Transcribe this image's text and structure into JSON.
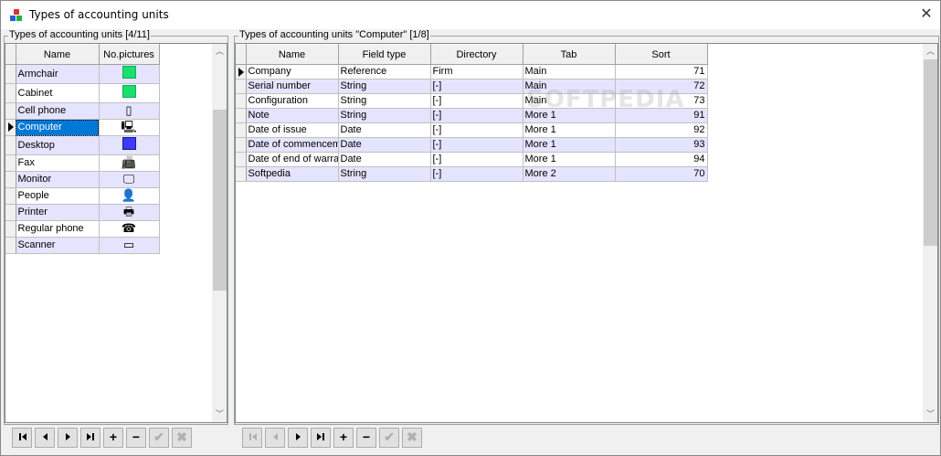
{
  "window": {
    "title": "Types of accounting units",
    "close_glyph": "✕",
    "app_icon": "cubes-icon"
  },
  "left": {
    "group_label": "Types of accounting units [4/11]",
    "columns": [
      "Name",
      "No.pictures"
    ],
    "rows": [
      {
        "name": "Armchair",
        "pic": "green-square"
      },
      {
        "name": "Cabinet",
        "pic": "green-square"
      },
      {
        "name": "Cell phone",
        "pic": "cell-phone-icon",
        "glyph": "▯"
      },
      {
        "name": "Computer",
        "pic": "computer-icon",
        "glyph": "🖳",
        "selected": true
      },
      {
        "name": "Desktop",
        "pic": "blue-square"
      },
      {
        "name": "Fax",
        "pic": "fax-icon",
        "glyph": "📠"
      },
      {
        "name": "Monitor",
        "pic": "monitor-icon",
        "glyph": "🖵"
      },
      {
        "name": "People",
        "pic": "person-icon",
        "glyph": "👤"
      },
      {
        "name": "Printer",
        "pic": "printer-icon",
        "glyph": "🖶"
      },
      {
        "name": "Regular phone",
        "pic": "phone-icon",
        "glyph": "☎"
      },
      {
        "name": "Scanner",
        "pic": "scanner-icon",
        "glyph": "▭"
      }
    ]
  },
  "right": {
    "group_label": "Types of accounting units \"Computer\" [1/8]",
    "columns": [
      "Name",
      "Field type",
      "Directory",
      "Tab",
      "Sort"
    ],
    "rows": [
      {
        "name": "Company",
        "type": "Reference",
        "dir": "Firm",
        "tab": "Main",
        "sort": "71",
        "current": true
      },
      {
        "name": "Serial number",
        "type": "String",
        "dir": "[-]",
        "tab": "Main",
        "sort": "72"
      },
      {
        "name": "Configuration",
        "type": "String",
        "dir": "[-]",
        "tab": "Main",
        "sort": "73"
      },
      {
        "name": "Note",
        "type": "String",
        "dir": "[-]",
        "tab": "More 1",
        "sort": "91"
      },
      {
        "name": "Date of issue",
        "type": "Date",
        "dir": "[-]",
        "tab": "More 1",
        "sort": "92"
      },
      {
        "name": "Date of commencement",
        "type": "Date",
        "dir": "[-]",
        "tab": "More 1",
        "sort": "93"
      },
      {
        "name": "Date of end of warranty",
        "type": "Date",
        "dir": "[-]",
        "tab": "More 1",
        "sort": "94"
      },
      {
        "name": "Softpedia",
        "type": "String",
        "dir": "[-]",
        "tab": "More 2",
        "sort": "70"
      }
    ]
  },
  "navigator": {
    "buttons": [
      {
        "name": "first-record-button",
        "kind": "first"
      },
      {
        "name": "prior-record-button",
        "kind": "prior"
      },
      {
        "name": "next-record-button",
        "kind": "next"
      },
      {
        "name": "last-record-button",
        "kind": "last"
      },
      {
        "name": "insert-record-button",
        "kind": "insert",
        "label": "+"
      },
      {
        "name": "delete-record-button",
        "kind": "delete",
        "label": "−"
      },
      {
        "name": "post-edit-button",
        "kind": "post",
        "label": "✔"
      },
      {
        "name": "cancel-edit-button",
        "kind": "cancel",
        "label": "✖"
      }
    ],
    "left_disabled": [
      "post",
      "cancel"
    ],
    "right_disabled": [
      "first",
      "prior",
      "post",
      "cancel"
    ]
  },
  "watermark": "SOFTPEDIA",
  "colors": {
    "alt_row": "#e4e4ff",
    "selection": "#0078d7",
    "green_pic": "#19e06a",
    "blue_pic": "#3b3bff"
  }
}
